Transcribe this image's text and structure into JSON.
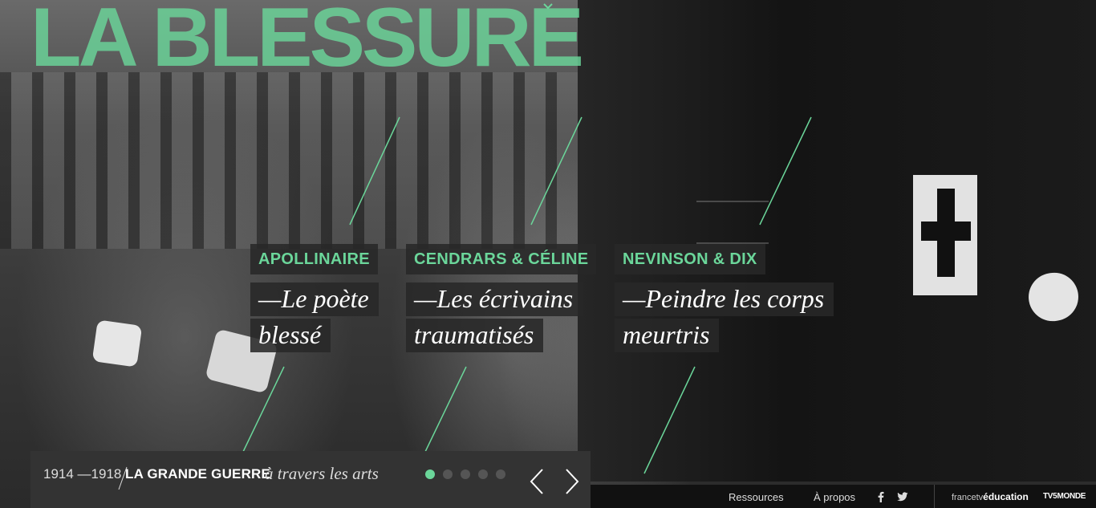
{
  "header": {
    "site_title": "LA BLESSURE"
  },
  "entries": [
    {
      "label": "APOLLINAIRE",
      "subtitle": "—Le poète blessé",
      "line1": "—Le poète",
      "line2": "blessé"
    },
    {
      "label": "CENDRARS & CÉLINE",
      "subtitle": "—Les écrivains traumatisés",
      "line1": "—Les écrivains",
      "line2": "traumatisés"
    },
    {
      "label": "NEVINSON & DIX",
      "subtitle": "—Peindre les corps meurtris",
      "line1": "—Peindre les corps",
      "line2": "meurtris"
    }
  ],
  "bottom_bar": {
    "date_range": "1914 —1918",
    "series_title": "LA GRANDE GUERRE",
    "series_tagline": "à travers les arts",
    "slides_total": 5,
    "active_slide": 1
  },
  "footer": {
    "resources": "Ressources",
    "about": "À propos",
    "brand_prefix": "francetv",
    "brand_suffix": "éducation",
    "partner": "TV5MONDE"
  },
  "icons": [
    "chevron-down-icon",
    "facebook-icon",
    "twitter-icon",
    "arrow-left-icon",
    "arrow-right-icon"
  ],
  "colors": {
    "accent": "#6bd69a",
    "panel": "#333333",
    "footer": "#111111",
    "label_bg": "#282828"
  }
}
